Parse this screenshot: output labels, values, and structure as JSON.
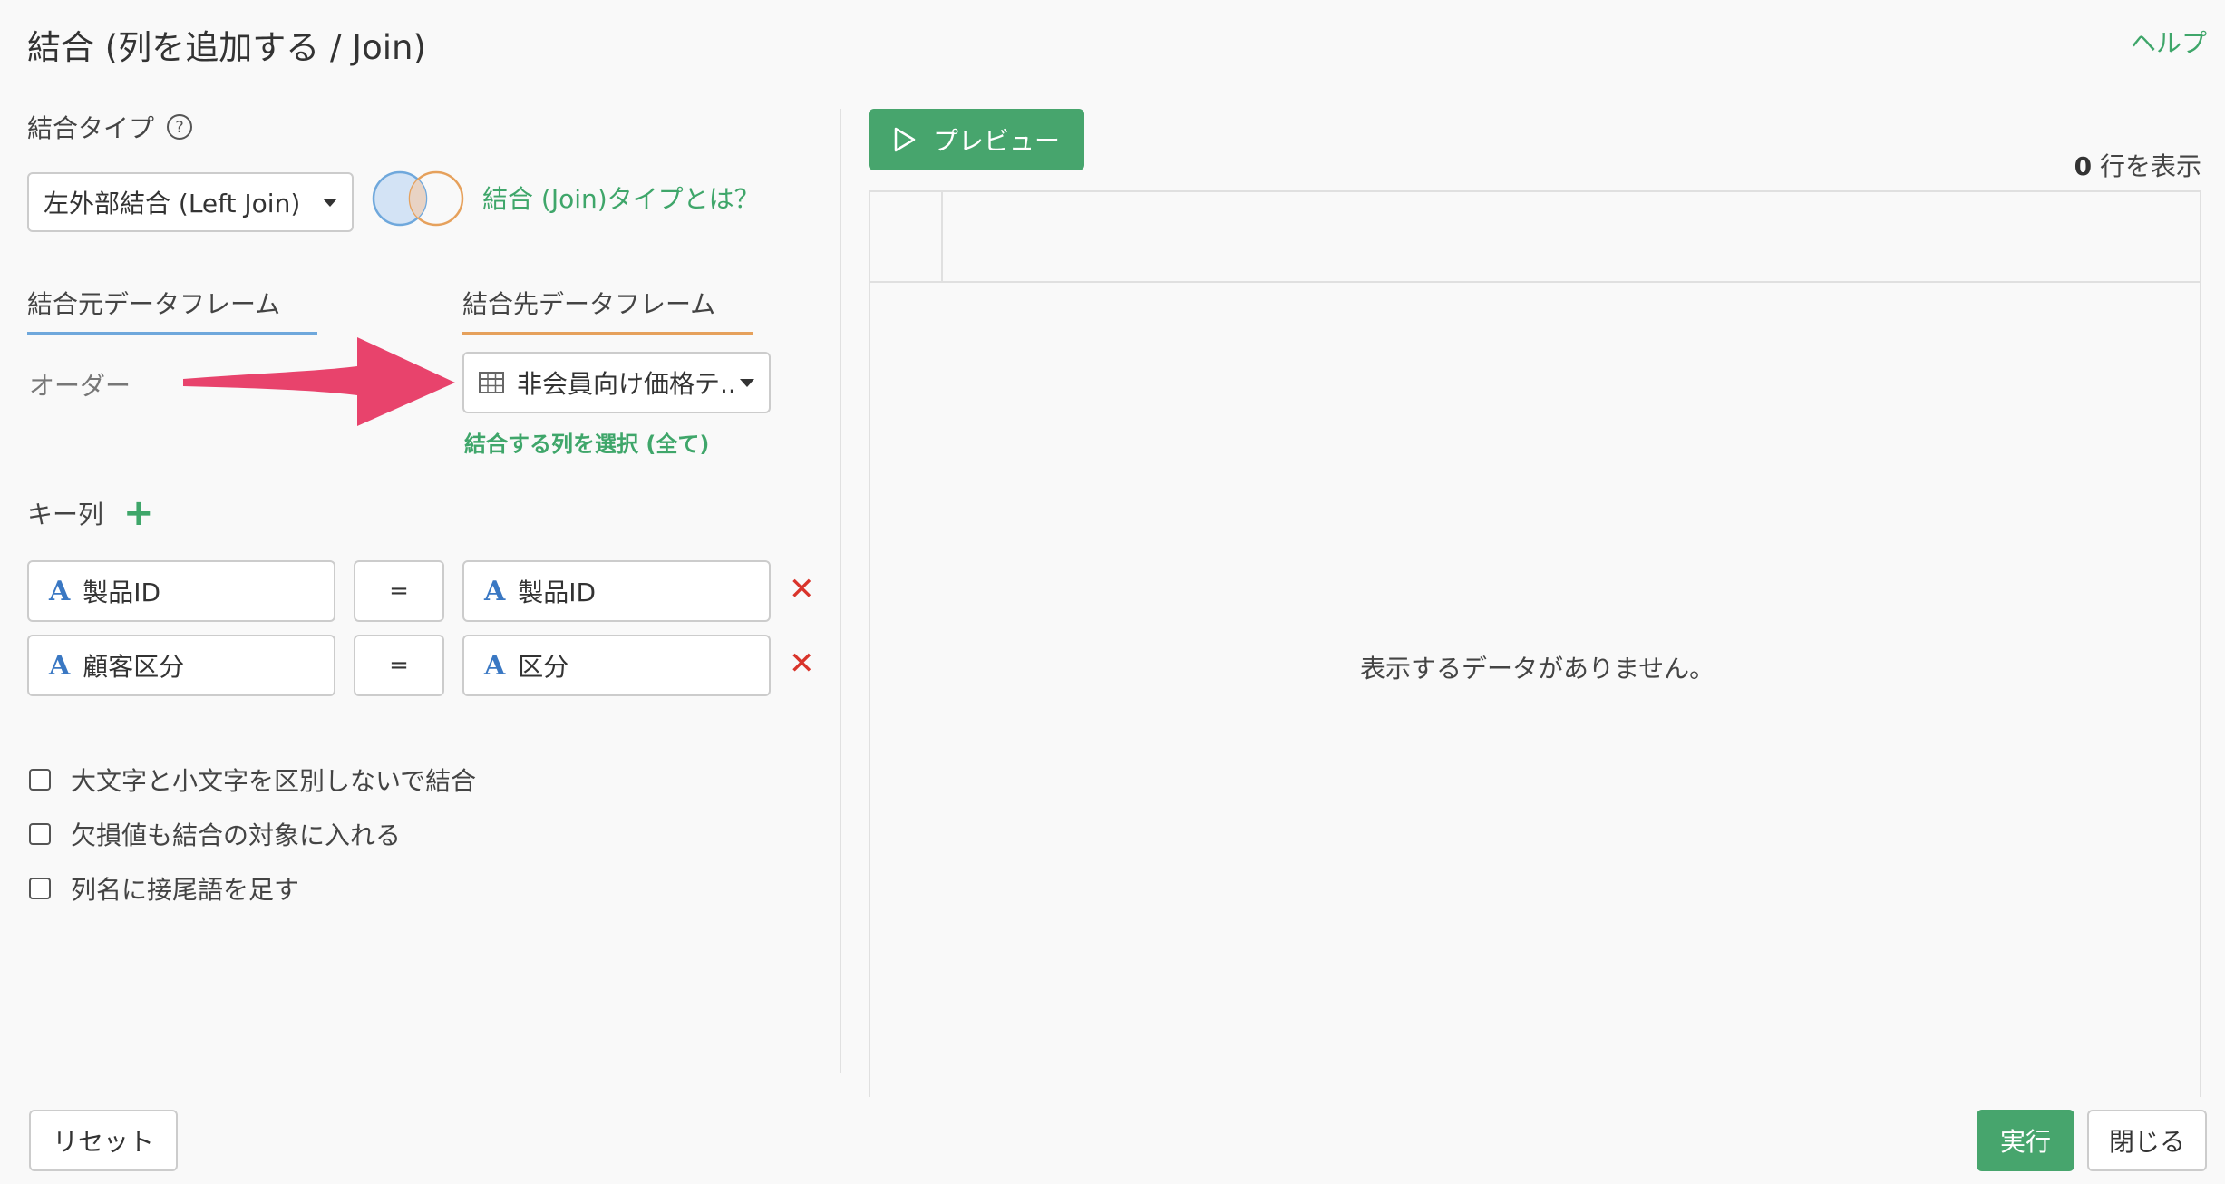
{
  "header": {
    "title": "結合 (列を追加する / Join)",
    "help_label": "ヘルプ"
  },
  "join_type": {
    "label": "結合タイプ",
    "help_icon_glyph": "?",
    "selected": "左外部結合 (Left Join)",
    "help_link": "結合 (Join)タイプとは？"
  },
  "dataframes": {
    "source_tab": "結合元データフレーム",
    "target_tab": "結合先データフレーム",
    "source_name": "オーダー",
    "target_selected": "非会員向け価格テ...",
    "select_columns_link": "結合する列を選択 (全て)"
  },
  "keys": {
    "label": "キー列",
    "add_glyph": "+",
    "rows": [
      {
        "left": "製品ID",
        "op": "=",
        "right": "製品ID"
      },
      {
        "left": "顧客区分",
        "op": "=",
        "right": "区分"
      }
    ],
    "type_glyph": "A",
    "delete_glyph": "✕"
  },
  "options": [
    "大文字と小文字を区別しないで結合",
    "欠損値も結合の対象に入れる",
    "列名に接尾語を足す"
  ],
  "preview": {
    "button_label": "プレビュー",
    "row_count": "0",
    "row_count_suffix": "行を表示",
    "empty_message": "表示するデータがありません。"
  },
  "footer": {
    "reset": "リセット",
    "run": "実行",
    "close": "閉じる"
  },
  "colors": {
    "accent_green": "#47a56d",
    "link_green": "#3fa66a",
    "source_blue": "#6fa8dc",
    "target_orange": "#e6a15c",
    "delete_red": "#d9342b",
    "arrow_pink": "#e8436c"
  },
  "icons": {
    "help": "question-circle-icon",
    "venn": "venn-diagram-icon",
    "table": "table-icon",
    "play": "play-icon",
    "caret": "caret-down-icon",
    "string_type": "string-type-icon",
    "delete": "close-icon",
    "add": "plus-icon",
    "annotation": "arrow-annotation"
  }
}
